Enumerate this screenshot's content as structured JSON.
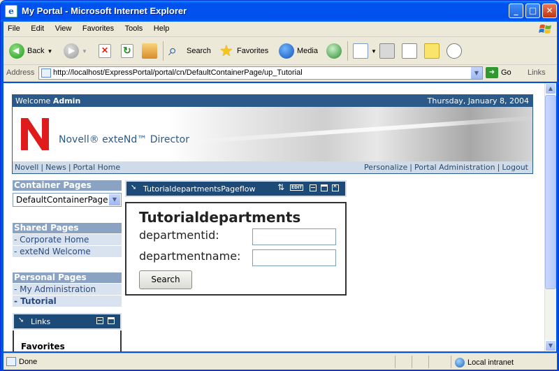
{
  "window": {
    "title": "My Portal - Microsoft Internet Explorer",
    "controls": [
      "_",
      "□",
      "✕"
    ]
  },
  "menu": [
    "File",
    "Edit",
    "View",
    "Favorites",
    "Tools",
    "Help"
  ],
  "toolbar": {
    "back": "Back",
    "search": "Search",
    "favorites": "Favorites",
    "media": "Media"
  },
  "address": {
    "label": "Address",
    "url": "http://localhost/ExpressPortal/portal/cn/DefaultContainerPage/up_Tutorial",
    "go": "Go",
    "links": "Links"
  },
  "portal": {
    "welcome_prefix": "Welcome",
    "user": "Admin",
    "date": "Thursday, January 8, 2004",
    "product": "Novell® exteNd™ Director",
    "nav_left": [
      "Novell",
      "News",
      "Portal Home"
    ],
    "nav_right": [
      "Personalize",
      "Portal Administration",
      "Logout"
    ]
  },
  "sidebar": {
    "container_header": "Container Pages",
    "container_selected": "DefaultContainerPage",
    "shared_header": "Shared Pages",
    "shared_items": [
      "- Corporate Home",
      "- exteNd Welcome"
    ],
    "personal_header": "Personal Pages",
    "personal_items": [
      "- My Administration",
      "- Tutorial"
    ],
    "links_title": "Links",
    "favorites": "Favorites"
  },
  "portlet": {
    "title": "TutorialdepartmentsPageflow",
    "edit": "EDIT",
    "form_title": "Tutorialdepartments",
    "label_id": "departmentid:",
    "label_name": "departmentname:",
    "button": "Search"
  },
  "status": {
    "text": "Done",
    "zone": "Local intranet"
  },
  "colors": {
    "portal_blue": "#2b5a8a",
    "sidebar_header": "#8aa3c2",
    "sidebar_item": "#d8e3ef",
    "novell_red": "#e01b1b"
  }
}
